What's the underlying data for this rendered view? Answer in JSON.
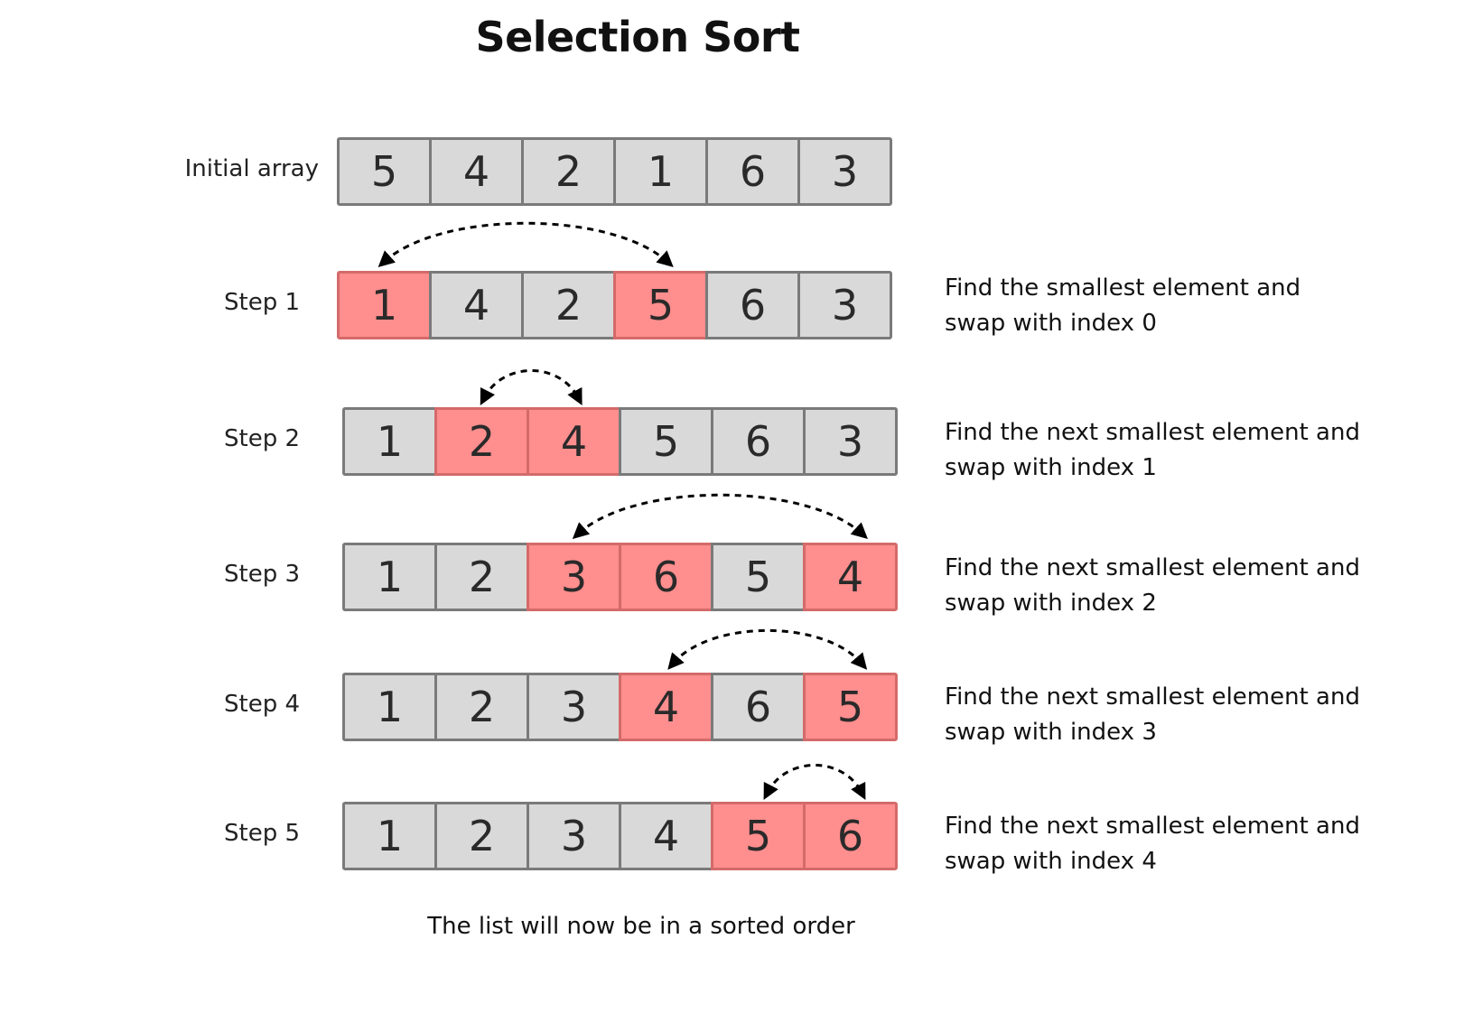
{
  "title": "Selection Sort",
  "colors": {
    "cell": "#d9d9d9",
    "highlight": "#ff8e8e",
    "border": "#7a7a7a",
    "highlight_border": "#d46a6a"
  },
  "rows": [
    {
      "label": "Initial array",
      "values": [
        "5",
        "4",
        "2",
        "1",
        "6",
        "3"
      ],
      "highlight": [],
      "swap": null,
      "description": []
    },
    {
      "label": "Step 1",
      "values": [
        "1",
        "4",
        "2",
        "5",
        "6",
        "3"
      ],
      "highlight": [
        0,
        3
      ],
      "swap": [
        0,
        3
      ],
      "description": [
        "Find the smallest element and",
        "swap with index 0"
      ]
    },
    {
      "label": "Step 2",
      "values": [
        "1",
        "2",
        "4",
        "5",
        "6",
        "3"
      ],
      "highlight": [
        1,
        2
      ],
      "swap": [
        1,
        2
      ],
      "description": [
        "Find the next smallest element and",
        "swap with index 1"
      ]
    },
    {
      "label": "Step 3",
      "values": [
        "1",
        "2",
        "3",
        "6",
        "5",
        "4"
      ],
      "highlight": [
        2,
        3,
        5
      ],
      "swap": [
        2,
        5
      ],
      "description": [
        "Find the next smallest element and",
        "swap with index 2"
      ]
    },
    {
      "label": "Step 4",
      "values": [
        "1",
        "2",
        "3",
        "4",
        "6",
        "5"
      ],
      "highlight": [
        3,
        5
      ],
      "swap": [
        3,
        5
      ],
      "description": [
        "Find the next smallest element and",
        "swap with index 3"
      ]
    },
    {
      "label": "Step 5",
      "values": [
        "1",
        "2",
        "3",
        "4",
        "5",
        "6"
      ],
      "highlight": [
        4,
        5
      ],
      "swap": [
        4,
        5
      ],
      "description": [
        "Find the next smallest element and",
        "swap with index 4"
      ]
    }
  ],
  "footer": "The list will now be in a sorted order"
}
